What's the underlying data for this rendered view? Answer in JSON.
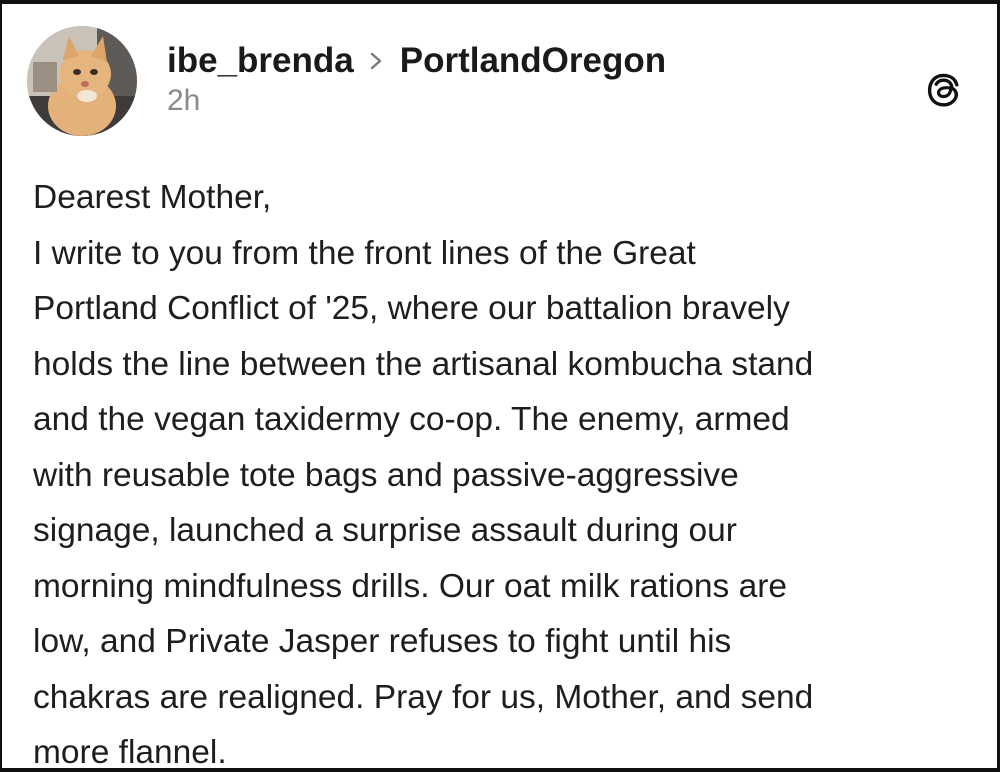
{
  "post": {
    "username": "ibe_brenda",
    "community": "PortlandOregon",
    "time": "2h",
    "lines": [
      "Dearest Mother,",
      "I write to you from the front lines of the Great",
      "Portland Conflict of '25, where our battalion bravely",
      "holds the line between the artisanal kombucha stand",
      "and the vegan taxidermy co-op. The enemy, armed",
      "with reusable tote bags and passive-aggressive",
      "signage, launched a surprise assault during our",
      "morning mindfulness drills. Our oat milk rations are",
      "low, and Private Jasper refuses to fight until his",
      "chakras are realigned. Pray for us, Mother, and send",
      "more flannel."
    ]
  },
  "icons": {
    "avatar": "cat-photo",
    "separator": "chevron-right-icon",
    "brand": "threads-logo-icon"
  },
  "colors": {
    "text": "#1e1e1e",
    "muted": "#8a8a8a",
    "background": "#ffffff",
    "border": "#101010"
  }
}
